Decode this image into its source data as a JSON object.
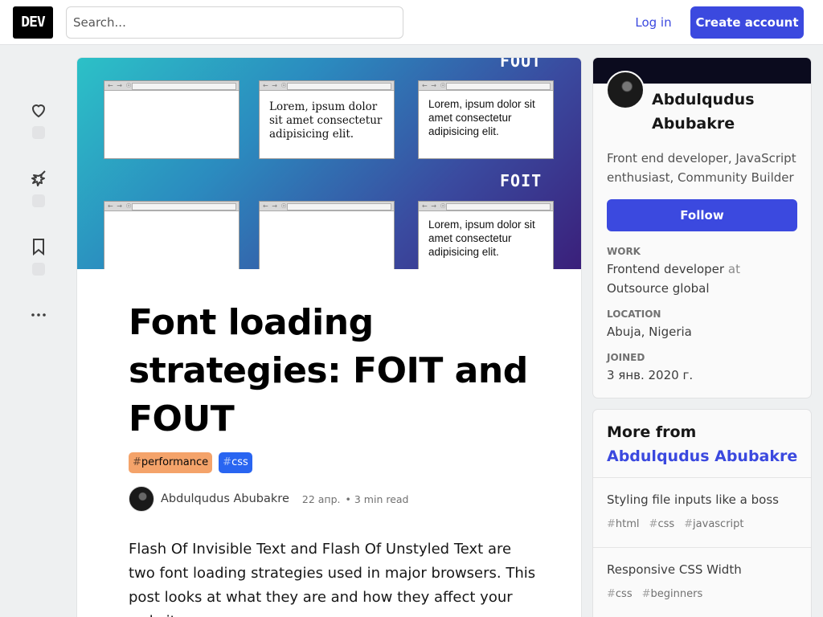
{
  "header": {
    "logo": "DEV",
    "search_placeholder": "Search...",
    "login_label": "Log in",
    "create_label": "Create account"
  },
  "cover": {
    "fout_label": "FOUT",
    "foit_label": "FOIT",
    "frame_text": "Lorem, ipsum dolor sit amet consectetur adipisicing elit.",
    "frame_dots": "← → ☉"
  },
  "article": {
    "title": "Font loading strategies: FOIT and FOUT",
    "tags": [
      {
        "hash": "#",
        "name": "performance",
        "color": "#f4a36a"
      },
      {
        "hash": "#",
        "name": "css",
        "color": "#2965f1"
      }
    ],
    "author": "Abdulqudus Abubakre",
    "date": "22 апр.",
    "separator": "•",
    "read_time": "3 min read",
    "intro": "Flash Of Invisible Text and Flash Of Unstyled Text are two font loading strategies used in major browsers. This post looks at what they are and how they affect your website."
  },
  "profile": {
    "name": "Abdulqudus Abubakre",
    "bio": "Front end developer, JavaScript enthusiast, Community Builder",
    "follow_label": "Follow",
    "work_label": "WORK",
    "work_role": "Frontend developer",
    "work_at": "at",
    "work_company": "Outsource global",
    "location_label": "LOCATION",
    "location": "Abuja, Nigeria",
    "joined_label": "JOINED",
    "joined": "3 янв. 2020 г."
  },
  "more": {
    "prefix": "More from",
    "author": "Abdulqudus Abubakre",
    "items": [
      {
        "title": "Styling file inputs like a boss",
        "tags": [
          "html",
          "css",
          "javascript"
        ]
      },
      {
        "title": "Responsive CSS Width",
        "tags": [
          "css",
          "beginners"
        ]
      }
    ]
  },
  "colors": {
    "accent": "#3b49df",
    "background": "#eef0f1"
  },
  "icons": [
    "heart-icon",
    "unicorn-icon",
    "bookmark-icon",
    "more-icon"
  ]
}
